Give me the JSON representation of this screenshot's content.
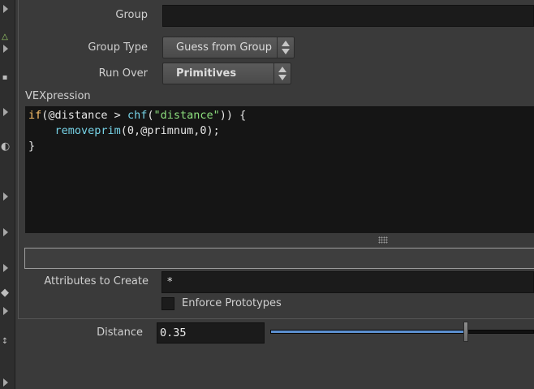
{
  "params": {
    "group": {
      "label": "Group",
      "value": ""
    },
    "group_type": {
      "label": "Group Type",
      "value": "Guess from Group"
    },
    "run_over": {
      "label": "Run Over",
      "value": "Primitives"
    },
    "vexpression": {
      "label": "VEXpression",
      "lines": [
        [
          {
            "t": "if",
            "c": "kw"
          },
          {
            "t": "(@distance > ",
            "c": ""
          },
          {
            "t": "chf",
            "c": "fn"
          },
          {
            "t": "(",
            "c": ""
          },
          {
            "t": "\"distance\"",
            "c": "str"
          },
          {
            "t": ")) {",
            "c": ""
          }
        ],
        [
          {
            "t": "    ",
            "c": ""
          },
          {
            "t": "removeprim",
            "c": "fn"
          },
          {
            "t": "(0,@primnum,0);",
            "c": ""
          }
        ],
        [
          {
            "t": "}",
            "c": ""
          }
        ]
      ]
    },
    "attributes_to_create": {
      "label": "Attributes to Create",
      "value": "*"
    },
    "enforce_prototypes": {
      "label": "Enforce Prototypes",
      "checked": false
    }
  },
  "distance": {
    "label": "Distance",
    "value": "0.35",
    "slider_fraction": 0.74
  },
  "colors": {
    "accent": "#5b8fcf",
    "code_keyword": "#ffc36b",
    "code_function": "#77d4e8",
    "code_string": "#8de07e"
  },
  "icons": [
    "tool-icon",
    "expand-arrow-icon"
  ]
}
